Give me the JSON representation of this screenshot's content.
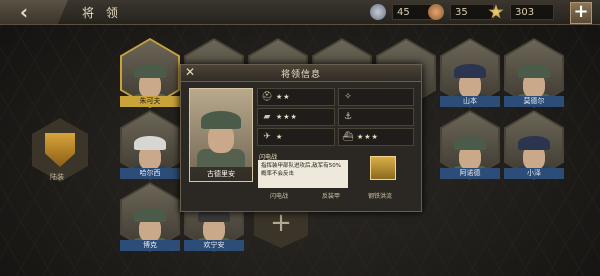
{
  "header": {
    "back_icon": "back-arrow-icon",
    "title": "将 领",
    "resources": [
      {
        "icon": "silver-medal-icon",
        "value": "45",
        "color": "#8b97a6"
      },
      {
        "icon": "bronze-medal-icon",
        "value": "35",
        "color": "#b98350"
      },
      {
        "icon": "star-badge-icon",
        "value": "303",
        "color": "#d9b048"
      }
    ],
    "add_icon": "plus-icon"
  },
  "generals_top": [
    {
      "name": "朱可夫",
      "tag": "yellow"
    },
    {
      "name": "",
      "tag": ""
    },
    {
      "name": "",
      "tag": ""
    },
    {
      "name": "",
      "tag": ""
    },
    {
      "name": "",
      "tag": ""
    },
    {
      "name": "山本",
      "tag": "blue"
    },
    {
      "name": "莫德尔",
      "tag": "blue"
    }
  ],
  "generals_mid": [
    {
      "name": "哈尔西",
      "tag": "blue"
    },
    {
      "name": "阿诺德",
      "tag": "blue"
    },
    {
      "name": "小泽",
      "tag": "blue"
    }
  ],
  "generals_bottom": [
    {
      "name": "博克",
      "tag": "blue"
    },
    {
      "name": "欢宁安",
      "tag": "blue"
    }
  ],
  "left_panel": {
    "label": "陆装",
    "icon": "shield-icon"
  },
  "modal": {
    "title": "将领信息",
    "close_icon": "close-icon",
    "general_name": "古德里安",
    "stats": [
      {
        "icon": "infantry-icon",
        "glyph": "⛑",
        "stars": "★★"
      },
      {
        "icon": "artillery-icon",
        "glyph": "✧",
        "stars": ""
      },
      {
        "icon": "tank-icon",
        "glyph": "▰",
        "stars": "★★★"
      },
      {
        "icon": "navy-icon",
        "glyph": "⚓",
        "stars": ""
      },
      {
        "icon": "aircraft-icon",
        "glyph": "✈",
        "stars": "★"
      },
      {
        "icon": "ship-icon",
        "glyph": "⛴",
        "stars": "★★★"
      }
    ],
    "skill_name": "闪电战",
    "skill_desc": "指挥装甲部队进攻后,敌军有50%概率不会反击",
    "skills": [
      {
        "label": "闪电战",
        "icon": "blitz-skill-icon"
      },
      {
        "label": "反装甲",
        "icon": "antitank-skill-icon"
      },
      {
        "label": "钢铁洪流",
        "icon": "iron-torrent-skill-icon"
      }
    ]
  }
}
